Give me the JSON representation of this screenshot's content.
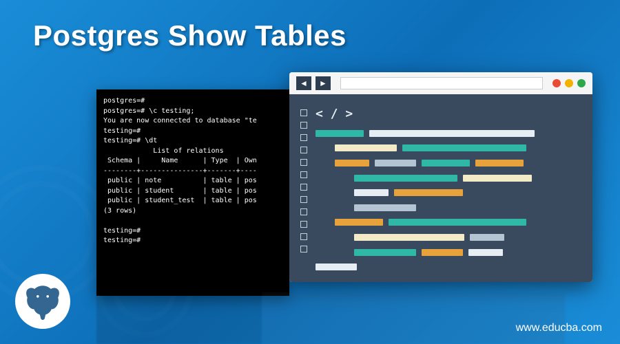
{
  "title": "Postgres Show Tables",
  "terminal": {
    "lines": [
      "postgres=#",
      "postgres=# \\c testing;",
      "You are now connected to database \"te",
      "testing=#",
      "testing=# \\dt",
      "            List of relations",
      " Schema |     Name      | Type  | Own",
      "--------+---------------+-------+----",
      " public | note          | table | pos",
      " public | student       | table | pos",
      " public | student_test  | table | pos",
      "(3 rows)",
      "",
      "testing=#",
      "testing=#"
    ]
  },
  "editor": {
    "nav_back": "◄",
    "nav_fwd": "►",
    "tag_glyph": "< / >"
  },
  "footer_url": "www.educba.com"
}
